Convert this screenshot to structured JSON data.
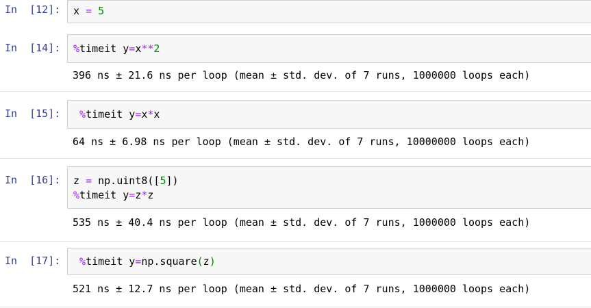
{
  "cells": [
    {
      "prompt": "In  [12]:",
      "lines": [
        [
          {
            "t": "x ",
            "c": "name"
          },
          {
            "t": "=",
            "c": "op"
          },
          {
            "t": " ",
            "c": "sp"
          },
          {
            "t": "5",
            "c": "num"
          }
        ]
      ],
      "output": ""
    },
    {
      "prompt": "In  [14]:",
      "lines": [
        [
          {
            "t": "%",
            "c": "magic"
          },
          {
            "t": "timeit y",
            "c": "name"
          },
          {
            "t": "=",
            "c": "op"
          },
          {
            "t": "x",
            "c": "name"
          },
          {
            "t": "**",
            "c": "op"
          },
          {
            "t": "2",
            "c": "num"
          }
        ]
      ],
      "output": "396 ns ± 21.6 ns per loop (mean ± std. dev. of 7 runs, 1000000 loops each)"
    },
    {
      "prompt": "In  [15]:",
      "lines": [
        [
          {
            "t": " ",
            "c": "sp"
          },
          {
            "t": "%",
            "c": "magic"
          },
          {
            "t": "timeit y",
            "c": "name"
          },
          {
            "t": "=",
            "c": "op"
          },
          {
            "t": "x",
            "c": "name"
          },
          {
            "t": "*",
            "c": "op"
          },
          {
            "t": "x",
            "c": "name"
          }
        ]
      ],
      "output": "64 ns ± 6.98 ns per loop (mean ± std. dev. of 7 runs, 10000000 loops each)"
    },
    {
      "prompt": "In  [16]:",
      "lines": [
        [
          {
            "t": "z ",
            "c": "name"
          },
          {
            "t": "=",
            "c": "op"
          },
          {
            "t": " np.uint8([",
            "c": "name"
          },
          {
            "t": "5",
            "c": "num"
          },
          {
            "t": "])",
            "c": "name"
          }
        ],
        [
          {
            "t": "%",
            "c": "magic"
          },
          {
            "t": "timeit y",
            "c": "name"
          },
          {
            "t": "=",
            "c": "op"
          },
          {
            "t": "z",
            "c": "name"
          },
          {
            "t": "*",
            "c": "op"
          },
          {
            "t": "z",
            "c": "name"
          }
        ]
      ],
      "output": "535 ns ± 40.4 ns per loop (mean ± std. dev. of 7 runs, 1000000 loops each)"
    },
    {
      "prompt": "In  [17]:",
      "lines": [
        [
          {
            "t": " ",
            "c": "sp"
          },
          {
            "t": "%",
            "c": "magic"
          },
          {
            "t": "timeit y",
            "c": "name"
          },
          {
            "t": "=",
            "c": "op"
          },
          {
            "t": "np.square",
            "c": "name"
          },
          {
            "t": "(",
            "c": "num"
          },
          {
            "t": "z",
            "c": "name"
          },
          {
            "t": ")",
            "c": "num"
          }
        ]
      ],
      "output": "521 ns ± 12.7 ns per loop (mean ± std. dev. of 7 runs, 1000000 loops each)"
    }
  ]
}
